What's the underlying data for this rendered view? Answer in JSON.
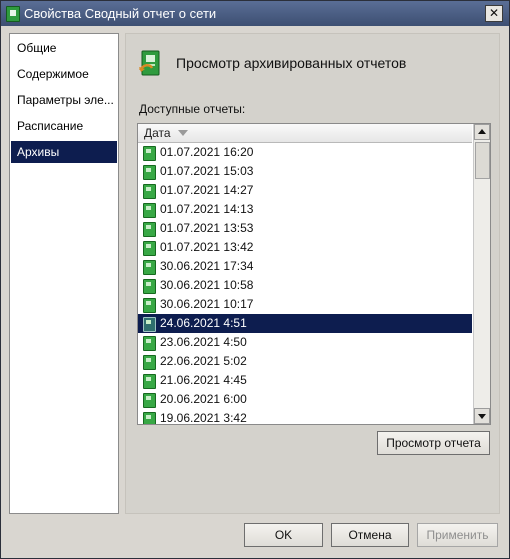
{
  "window": {
    "title": "Свойства Сводный отчет о сети",
    "close_label": "✕"
  },
  "nav": {
    "items": [
      {
        "label": "Общие"
      },
      {
        "label": "Содержимое"
      },
      {
        "label": "Параметры эле..."
      },
      {
        "label": "Расписание"
      },
      {
        "label": "Архивы"
      }
    ],
    "selected_index": 4
  },
  "panel": {
    "header_title": "Просмотр архивированных отчетов",
    "available_label": "Доступные отчеты:",
    "column_date": "Дата",
    "rows": [
      {
        "date": "01.07.2021 16:20"
      },
      {
        "date": "01.07.2021 15:03"
      },
      {
        "date": "01.07.2021 14:27"
      },
      {
        "date": "01.07.2021 14:13"
      },
      {
        "date": "01.07.2021 13:53"
      },
      {
        "date": "01.07.2021 13:42"
      },
      {
        "date": "30.06.2021 17:34"
      },
      {
        "date": "30.06.2021 10:58"
      },
      {
        "date": "30.06.2021 10:17"
      },
      {
        "date": "24.06.2021 4:51"
      },
      {
        "date": "23.06.2021 4:50"
      },
      {
        "date": "22.06.2021 5:02"
      },
      {
        "date": "21.06.2021 4:45"
      },
      {
        "date": "20.06.2021 6:00"
      },
      {
        "date": "19.06.2021 3:42"
      }
    ],
    "selected_row": 9,
    "view_button": "Просмотр отчета"
  },
  "footer": {
    "ok": "OK",
    "cancel": "Отмена",
    "apply": "Применить"
  },
  "colors": {
    "selection": "#0d1d4f",
    "titlebar": "#3d4f72",
    "report_icon": "#38a845"
  }
}
